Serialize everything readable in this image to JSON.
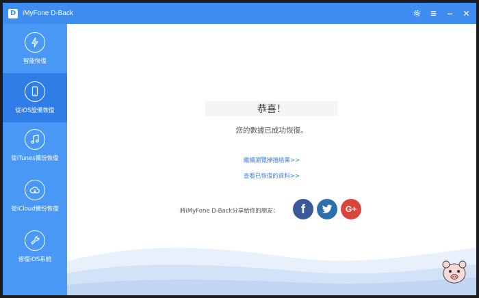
{
  "window": {
    "title": "iMyFone D-Back",
    "logo_letter": "D",
    "icons": [
      "gear-icon",
      "menu-icon",
      "minimize-icon",
      "close-icon"
    ]
  },
  "sidebar": {
    "items": [
      {
        "label": "智能恢復",
        "icon": "lightning-refresh-icon",
        "active": false
      },
      {
        "label": "從iOS設備恢復",
        "icon": "phone-refresh-icon",
        "active": true
      },
      {
        "label": "從iTunes備份恢復",
        "icon": "music-refresh-icon",
        "active": false
      },
      {
        "label": "從iCloud備份恢復",
        "icon": "cloud-refresh-icon",
        "active": false
      },
      {
        "label": "修復iOS系統",
        "icon": "wrench-icon",
        "active": false
      }
    ]
  },
  "main": {
    "congrats": "恭喜！",
    "subtitle": "您的數據已成功恢復。",
    "links": [
      "繼續瀏覽掃描結果>>",
      "查看已恢復的資料>>"
    ],
    "share_label": "將iMyFone D-Back分享給你的朋友：",
    "social": {
      "facebook": "f",
      "google": "G+"
    }
  },
  "colors": {
    "accent": "#3f8df0",
    "sidebar": "#4a98f5",
    "sidebar_active": "#2f7de6",
    "link": "#3d7fdc"
  }
}
